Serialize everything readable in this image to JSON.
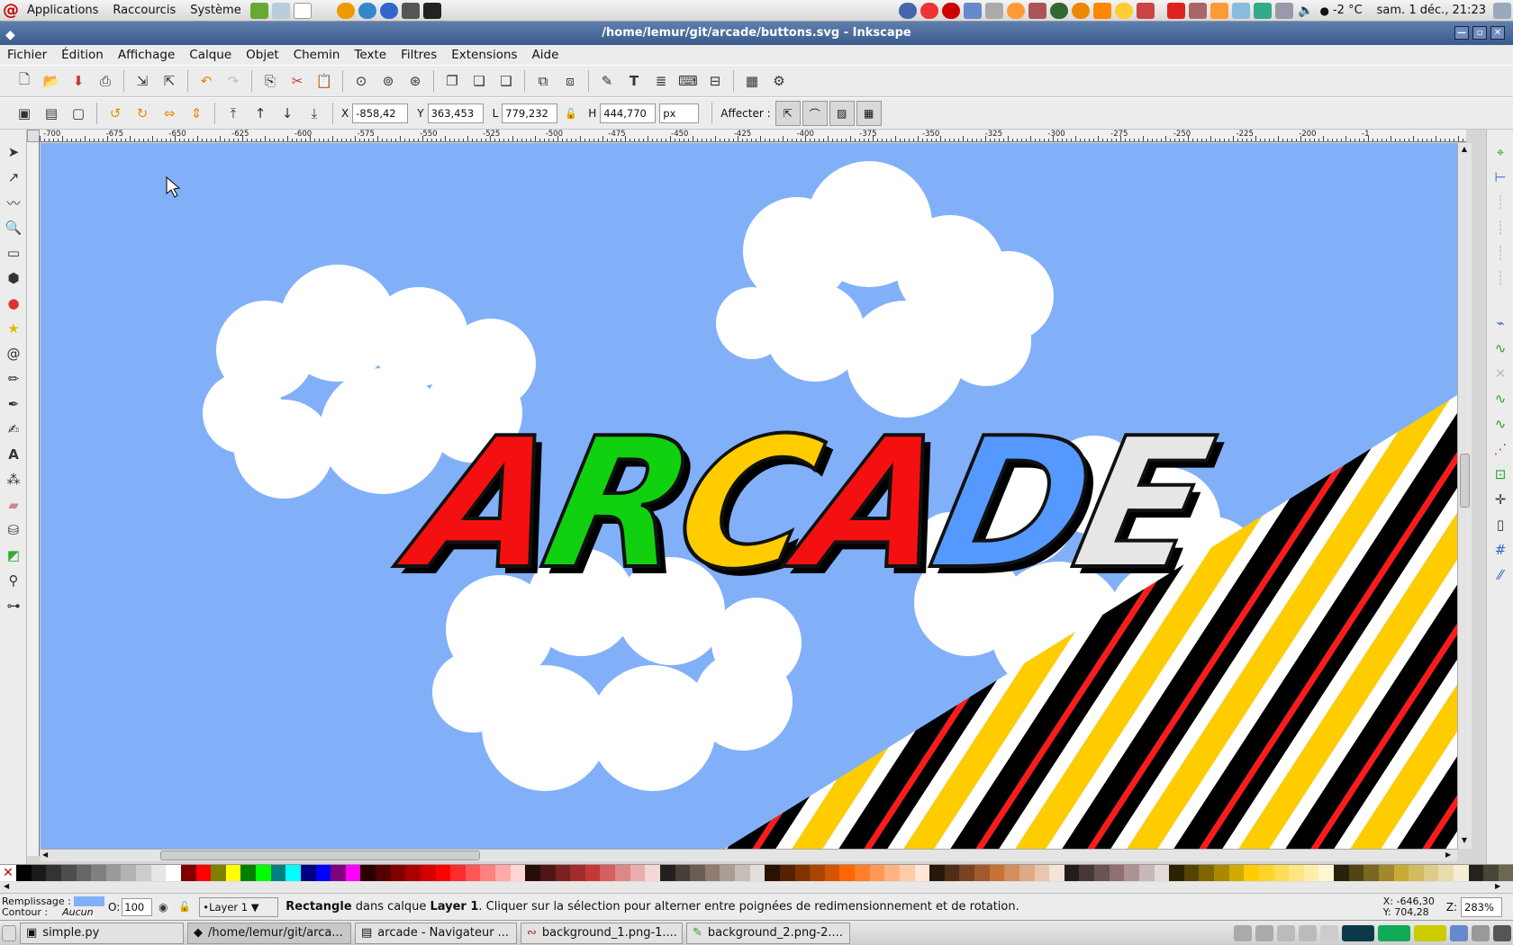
{
  "top_panel": {
    "applications": "Applications",
    "shortcuts": "Raccourcis",
    "system": "Système",
    "weather": "-2 °C",
    "clock": "sam.  1 déc., 21:23"
  },
  "window": {
    "title": "/home/lemur/git/arcade/buttons.svg - Inkscape"
  },
  "menu": [
    "Fichier",
    "Édition",
    "Affichage",
    "Calque",
    "Objet",
    "Chemin",
    "Texte",
    "Filtres",
    "Extensions",
    "Aide"
  ],
  "tool_controls": {
    "x_label": "X",
    "x_value": "-858,42",
    "y_label": "Y",
    "y_value": "363,453",
    "w_label": "L",
    "w_value": "779,232",
    "h_label": "H",
    "h_value": "444,770",
    "unit": "px",
    "affect_label": "Affecter :"
  },
  "ruler_labels": [
    "-700",
    "-675",
    "-650",
    "-625",
    "-600",
    "-575",
    "-550",
    "-525",
    "-500",
    "-475",
    "-450",
    "-425",
    "-400",
    "-375",
    "-350",
    "-325",
    "-300",
    "-275",
    "-250",
    "-225",
    "-200",
    "-1"
  ],
  "canvas": {
    "text": "ARCADE",
    "sky_color": "#82b0f8"
  },
  "status": {
    "fill_label": "Remplissage :",
    "stroke_label": "Contour :",
    "stroke_value": "Aucun",
    "opacity_label": "O:",
    "opacity_value": "100",
    "layer": "•Layer 1",
    "message_bold1": "Rectangle",
    "message_mid": " dans calque ",
    "message_bold2": "Layer 1",
    "message_rest": ". Cliquer sur la sélection pour alterner entre poignées de redimensionnement et de rotation.",
    "cursor_x": "X: -646,30",
    "cursor_y": "Y:  704,28",
    "zoom_label": "Z:",
    "zoom_value": "283%"
  },
  "taskbar": [
    {
      "label": "simple.py",
      "active": false
    },
    {
      "label": "/home/lemur/git/arca...",
      "active": true
    },
    {
      "label": "arcade - Navigateur ...",
      "active": false
    },
    {
      "label": "background_1.png-1....",
      "active": false
    },
    {
      "label": "background_2.png-2....",
      "active": false
    }
  ]
}
